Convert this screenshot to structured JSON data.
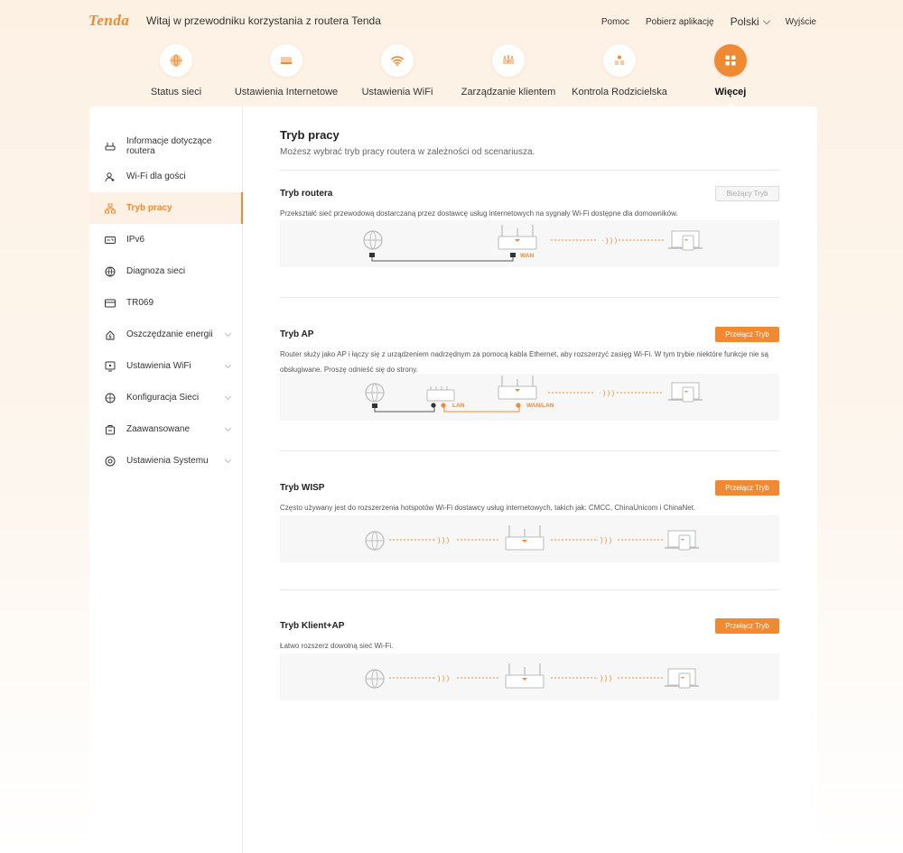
{
  "header": {
    "logo": "Tenda",
    "welcome": "Witaj w przewodniku korzystania z routera Tenda",
    "links": {
      "help": "Pomoc",
      "download_app": "Pobierz aplikację",
      "language": "Polski",
      "logout": "Wyjście"
    }
  },
  "nav": [
    {
      "label": "Status sieci",
      "icon": "globe-icon",
      "active": false
    },
    {
      "label": "Ustawienia Internetowe",
      "icon": "router-icon",
      "active": false
    },
    {
      "label": "Ustawienia WiFi",
      "icon": "wifi-icon",
      "active": false
    },
    {
      "label": "Zarządzanie klientem",
      "icon": "devices-icon",
      "active": false
    },
    {
      "label": "Kontrola Rodzicielska",
      "icon": "family-icon",
      "active": false
    },
    {
      "label": "Więcej",
      "icon": "grid-icon",
      "active": true
    }
  ],
  "sidebar": [
    {
      "label": "Informacje dotyczące routera",
      "icon": "router-info-icon",
      "expandable": false,
      "active": false
    },
    {
      "label": "Wi-Fi dla gości",
      "icon": "guest-user-icon",
      "expandable": false,
      "active": false
    },
    {
      "label": "Tryb pracy",
      "icon": "mode-network-icon",
      "expandable": false,
      "active": true
    },
    {
      "label": "IPv6",
      "icon": "ipv6-icon",
      "expandable": false,
      "active": false
    },
    {
      "label": "Diagnoza sieci",
      "icon": "globe-diagnostic-icon",
      "expandable": false,
      "active": false
    },
    {
      "label": "TR069",
      "icon": "tr069-icon",
      "expandable": false,
      "active": false
    },
    {
      "label": "Oszczędzanie energii",
      "icon": "energy-icon",
      "expandable": true,
      "active": false
    },
    {
      "label": "Ustawienia WiFi",
      "icon": "wifi-settings-icon",
      "expandable": true,
      "active": false
    },
    {
      "label": "Konfiguracja Sieci",
      "icon": "network-config-icon",
      "expandable": true,
      "active": false
    },
    {
      "label": "Zaawansowane",
      "icon": "advanced-icon",
      "expandable": true,
      "active": false
    },
    {
      "label": "Ustawienia Systemu",
      "icon": "system-settings-icon",
      "expandable": true,
      "active": false
    }
  ],
  "main": {
    "title": "Tryb pracy",
    "subtitle": "Możesz wybrać tryb pracy routera w zależności od scenariusza.",
    "modes": [
      {
        "title": "Tryb routera",
        "description": "Przekształć sieć przewodową dostarczaną przez dostawcę usług internetowych na sygnały Wi-Fi dostępne dla domowników.",
        "button": "Bieżący Tryb",
        "current": true,
        "diagram_labels": [
          "WAN"
        ]
      },
      {
        "title": "Tryb AP",
        "description": "Router służy jako AP i łączy się z urządzeniem nadrzędnym za pomocą kabla Ethernet, aby rozszerzyć zasięg Wi-Fi. W tym trybie niektóre funkcje nie są obsługiwane. Proszę odnieść się do strony.",
        "button": "Przełącz Tryb",
        "current": false,
        "diagram_labels": [
          "LAN",
          "WAN/LAN"
        ]
      },
      {
        "title": "Tryb WISP",
        "description": "Często używany jest do rozszerzenia hotspotów Wi-Fi dostawcy usług internetowych, takich jak: CMCC, ChinaUnicom i ChinaNet.",
        "button": "Przełącz Tryb",
        "current": false,
        "diagram_labels": []
      },
      {
        "title": "Tryb Klient+AP",
        "description": "Łatwo rozszerz dowolną sieć Wi-Fi.",
        "button": "Przełącz Tryb",
        "current": false,
        "diagram_labels": []
      }
    ]
  },
  "colors": {
    "accent": "#f08a32",
    "active_bg": "#fdf1e6",
    "diagram_bg": "#f7f7f7"
  }
}
